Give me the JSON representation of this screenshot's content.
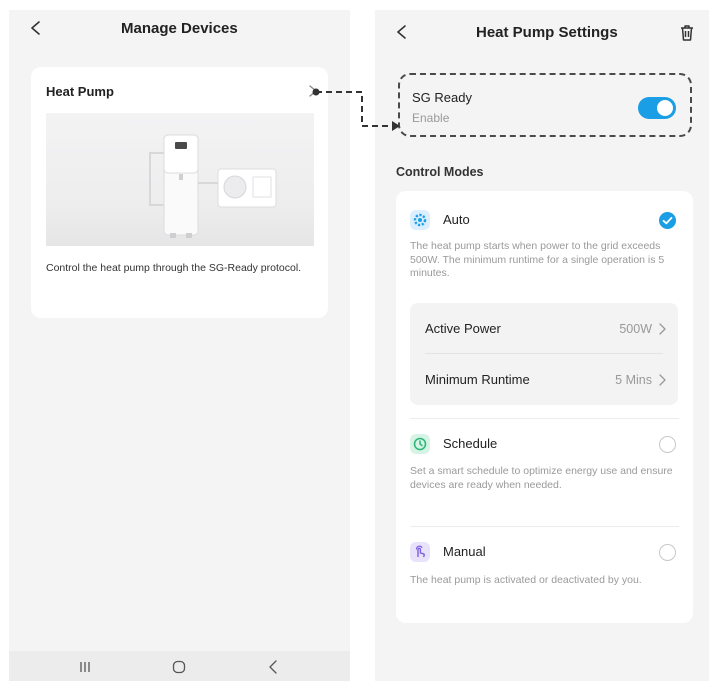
{
  "left_screen": {
    "title": "Manage Devices",
    "device_card": {
      "name": "Heat Pump",
      "description": "Control the heat pump through the SG-Ready protocol."
    }
  },
  "right_screen": {
    "title": "Heat Pump Settings",
    "sg_ready": {
      "label": "SG Ready",
      "sublabel": "Enable",
      "enabled": true
    },
    "section_title": "Control Modes",
    "modes": [
      {
        "label": "Auto",
        "icon": "gear-icon",
        "selected": true,
        "description": "The heat pump starts when power to the grid exceeds 500W. The minimum runtime for a single operation is 5 minutes."
      },
      {
        "label": "Schedule",
        "icon": "clock-icon",
        "selected": false,
        "description": "Set a smart schedule to optimize energy use and ensure devices are ready when needed."
      },
      {
        "label": "Manual",
        "icon": "hand-tap-icon",
        "selected": false,
        "description": "The heat pump is activated or deactivated by you."
      }
    ],
    "auto_params": [
      {
        "label": "Active Power",
        "value": "500W"
      },
      {
        "label": "Minimum Runtime",
        "value": "5 Mins"
      }
    ]
  },
  "colors": {
    "accent": "#1a9ee6",
    "auto_icon": "#1a9ee6",
    "schedule_icon": "#2db87a",
    "manual_icon": "#7b5fe0"
  }
}
